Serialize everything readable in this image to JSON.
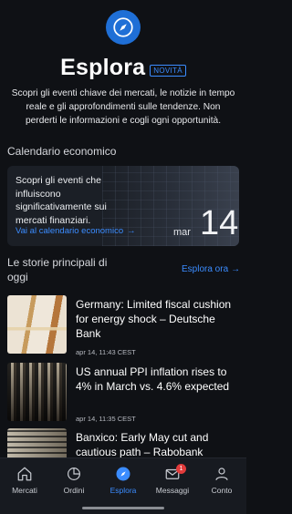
{
  "hero": {
    "icon": "compass-icon",
    "title": "Esplora",
    "badge": "NOVITÀ",
    "subtitle": "Scopri gli eventi chiave dei mercati, le notizie in tempo reale e gli approfondimenti sulle tendenze. Non perderti le informazioni e cogli ogni opportunità."
  },
  "calendar": {
    "section_title": "Calendario economico",
    "description": "Scopri gli eventi che influiscono significativamente sui mercati finanziari.",
    "link_label": "Vai al calendario economico",
    "month": "mar",
    "day": "14"
  },
  "stories": {
    "title": "Le storie principali di oggi",
    "explore_label": "Esplora ora",
    "items": [
      {
        "headline": "Germany: Limited fiscal cushion for energy shock – Deutsche Bank",
        "meta": "apr 14, 11:43 CEST"
      },
      {
        "headline": "US annual PPI inflation rises to 4% in March vs. 4.6% expected",
        "meta": "apr 14, 11:35 CEST"
      },
      {
        "headline": "Banxico: Early May cut and cautious path – Rabobank",
        "meta": ""
      }
    ]
  },
  "nav": {
    "items": [
      {
        "label": "Mercati",
        "icon": "home-icon"
      },
      {
        "label": "Ordini",
        "icon": "pie-chart-icon"
      },
      {
        "label": "Esplora",
        "icon": "compass-icon",
        "active": true
      },
      {
        "label": "Messaggi",
        "icon": "mail-icon",
        "badge": "1"
      },
      {
        "label": "Conto",
        "icon": "user-icon"
      }
    ]
  },
  "colors": {
    "accent": "#3b8cff",
    "background": "#0f1115",
    "card": "#1b1f26",
    "badge": "#e23b3b"
  }
}
